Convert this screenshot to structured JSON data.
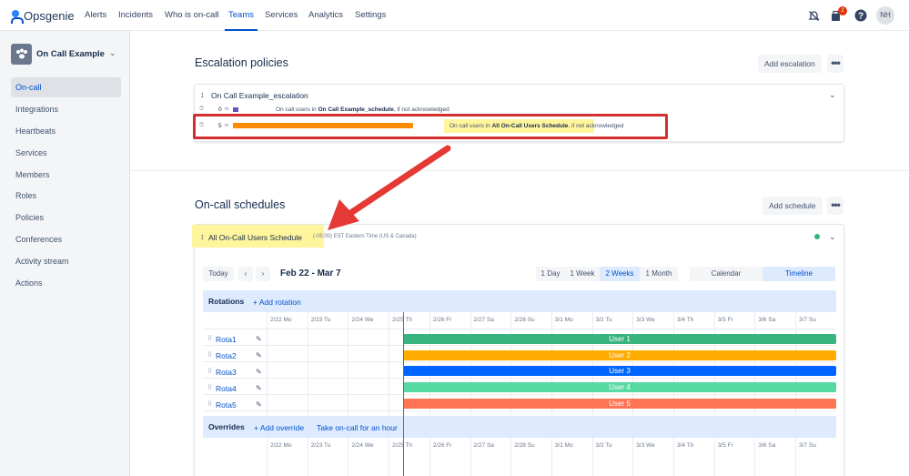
{
  "topnav": {
    "brand": "Opsgenie",
    "items": [
      "Alerts",
      "Incidents",
      "Who is on-call",
      "Teams",
      "Services",
      "Analytics",
      "Settings"
    ],
    "active_item": "Teams",
    "notification_count": "2",
    "user_initials": "NH",
    "icons": [
      "notifications-icon",
      "alerts-stack-icon",
      "help-icon"
    ]
  },
  "sidebar": {
    "team_name": "On Call Example",
    "items": [
      "On-call",
      "Integrations",
      "Heartbeats",
      "Services",
      "Members",
      "Roles",
      "Policies",
      "Conferences",
      "Activity stream",
      "Actions"
    ],
    "active_item": "On-call"
  },
  "escalation": {
    "title": "Escalation policies",
    "add_label": "Add escalation",
    "policy_name": "On Call Example_escalation",
    "rules": [
      {
        "delay": "0",
        "unit": "m",
        "text_prefix": "On call users in ",
        "target": "On Call Example_schedule",
        "text_suffix": ", if not acknowledged",
        "color": "#6554c0"
      },
      {
        "delay": "5",
        "unit": "m",
        "text_prefix": "On call users in ",
        "target": "All On-Call Users Schedule",
        "text_suffix": ", if not acknowledged",
        "color": "#ff8b00"
      }
    ]
  },
  "schedules": {
    "title": "On-call schedules",
    "add_label": "Add schedule",
    "schedule_name": "All On-Call Users Schedule",
    "timezone": "(-05:00) EST Eastern Time (US & Canada)",
    "today_label": "Today",
    "prev_icon": "‹",
    "next_icon": "›",
    "date_range": "Feb 22 - Mar 7",
    "ranges": [
      "1 Day",
      "1 Week",
      "2 Weeks",
      "1 Month"
    ],
    "selected_range": "2 Weeks",
    "views": [
      "Calendar",
      "Timeline"
    ],
    "selected_view": "Timeline",
    "rotations_label": "Rotations",
    "add_rotation": "+ Add rotation",
    "dates": [
      "2/22 Mo",
      "2/23 Tu",
      "2/24 We",
      "2/25 Th",
      "2/26 Fr",
      "2/27 Sa",
      "2/28 Su",
      "3/1 Mo",
      "3/2 Tu",
      "3/3 We",
      "3/4 Th",
      "3/5 Fr",
      "3/6 Sa",
      "3/7 Su"
    ],
    "rotations": [
      {
        "name": "Rota1",
        "user": "User 1",
        "color": "#36b37e"
      },
      {
        "name": "Rota2",
        "user": "User 2",
        "color": "#ffab00"
      },
      {
        "name": "Rota3",
        "user": "User 3",
        "color": "#0065ff"
      },
      {
        "name": "Rota4",
        "user": "User 4",
        "color": "#57d9a3"
      },
      {
        "name": "Rota5",
        "user": "User 5",
        "color": "#ff7452"
      }
    ],
    "overrides_label": "Overrides",
    "add_override": "+ Add override",
    "take_oncall": "Take on-call for an hour"
  },
  "colors": {
    "accent": "#0052cc",
    "highlight_box": "#d32f2f",
    "arrow": "#e53935",
    "highlight_yellow": "#fff59d",
    "now_line": "#e53935",
    "status_dot": "#36b37e"
  }
}
